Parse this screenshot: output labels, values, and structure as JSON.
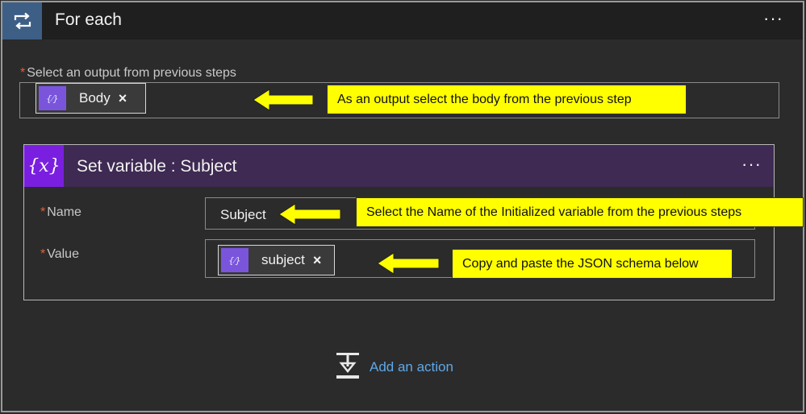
{
  "foreach": {
    "title": "For each",
    "menu": "···",
    "output_label": "Select an output from previous steps",
    "required_mark": "*",
    "token": {
      "icon": "{⁄}",
      "label": "Body",
      "close": "×"
    }
  },
  "set_variable": {
    "title": "Set variable : Subject",
    "menu": "···",
    "icon": "{𝑥}",
    "name_label": "Name",
    "name_value": "Subject",
    "value_label": "Value",
    "value_token": {
      "icon": "{⁄}",
      "label": "subject",
      "close": "×"
    }
  },
  "add_action": {
    "label": "Add an action"
  },
  "annotations": {
    "output": "As an output select the body from the previous step",
    "name": "Select the Name of the Initialized variable from the previous steps",
    "value": "Copy and paste the JSON schema below"
  },
  "colors": {
    "foreach_accent": "#3d5f86",
    "setvar_accent": "#7a1fe0",
    "setvar_header": "#3e2a52",
    "token_icon": "#7a55dc",
    "callout": "#ffff00",
    "link": "#5ea8e8",
    "required": "#e0603a"
  }
}
